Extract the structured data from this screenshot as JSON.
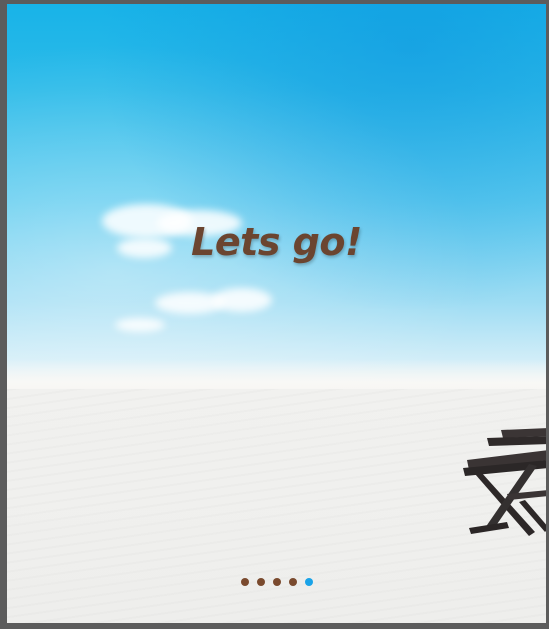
{
  "slide": {
    "headline": "Lets go!",
    "image_description_icon": "beach-chair-icon"
  },
  "pager": {
    "count": 5,
    "active_index": 4,
    "dot_color": "#7a4a2e",
    "active_color": "#1aa3e8"
  },
  "colors": {
    "sky_top": "#18b3e8",
    "sand": "#f2f3f2",
    "headline": "#6b4530",
    "frame": "#5c5c5c"
  }
}
